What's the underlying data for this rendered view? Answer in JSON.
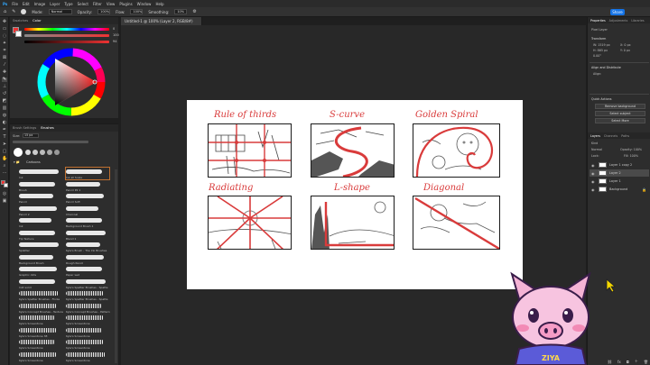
{
  "menu": [
    "Ps",
    "File",
    "Edit",
    "Image",
    "Layer",
    "Type",
    "Select",
    "Filter",
    "View",
    "Plugins",
    "Window",
    "Help"
  ],
  "options": {
    "mode_label": "Mode:",
    "mode_value": "Normal",
    "opacity_label": "Opacity:",
    "opacity_value": "100%",
    "flow_label": "Flow:",
    "flow_value": "100%",
    "smoothing_label": "Smoothing:",
    "smoothing_value": "10%",
    "share_label": "Share"
  },
  "color_panel": {
    "tabs": [
      "Swatches",
      "Color"
    ],
    "slider_values": [
      "0",
      "100",
      "94"
    ]
  },
  "brushes_panel": {
    "tabs": [
      "Brush Settings",
      "Brushes"
    ],
    "size_value": "15 px",
    "folder_name": "Cartoons",
    "brushes": [
      {
        "left": "Ink",
        "right": "Ink all Scale"
      },
      {
        "left": "Brush",
        "right": "Pencil P2 1"
      },
      {
        "left": "Pencil",
        "right": "Pencil Soft"
      },
      {
        "left": "Pencil 2",
        "right": "Charcoal"
      },
      {
        "left": "Ink",
        "right": "Background Brush 1"
      },
      {
        "left": "Tip Texture",
        "right": "Blend 1"
      },
      {
        "left": "Splatter",
        "right": "Kyle's Brush - The Ink Brushes"
      },
      {
        "left": "Background Brush",
        "right": "Rough Pencil"
      },
      {
        "left": "Graphic dots",
        "right": "Paper wet"
      },
      {
        "left": "Inkt solid",
        "right": "Kyle's Spatter Brushes - Spatte"
      },
      {
        "left": "Kyle's Spatter Brushes - Flicke",
        "right": "Kyle's Spatter Brushes - Spatte"
      },
      {
        "left": "Kyle's Concept Brushes - Texture",
        "right": "Kyle's Concept Brushes - Pattern"
      },
      {
        "left": "Kyle's Screentone",
        "right": "Kyle's Screentone"
      },
      {
        "left": "Kyle's Screentone 38",
        "right": "Kyle's Screentone"
      },
      {
        "left": "Kyle's Screentone",
        "right": "Kyle's Screentone"
      },
      {
        "left": "Kyle's Screentone",
        "right": "Kyle's Screentone"
      }
    ]
  },
  "document": {
    "tab_title": "Untitled-1 @ 100% (Layer 2, RGB/8#)",
    "zoom": "100%"
  },
  "artboard": {
    "labels": [
      "Rule of thirds",
      "S-curve",
      "Golden Spiral",
      "Radiating",
      "L-shape",
      "Diagonal"
    ],
    "accent_color": "#d93b3b"
  },
  "right_panel": {
    "top_tabs": [
      "Properties",
      "Adjustments",
      "Libraries"
    ],
    "pixel_layer": "Pixel Layer",
    "transform_label": "Transform",
    "transform_values": [
      "W: 1519 px",
      "H: 865 px",
      "X: 0 px",
      "Y: 0 px",
      "0.00°"
    ],
    "align_label": "Align and Distribute",
    "align_sub": "Align:",
    "quick_actions": "Quick Actions",
    "buttons": [
      "Remove background",
      "Select subject",
      "Select More"
    ],
    "layer_tabs": [
      "Layers",
      "Channels",
      "Paths"
    ],
    "kind_label": "Kind",
    "blend_mode": "Normal",
    "opacity": "Opacity: 100%",
    "lock_label": "Lock:",
    "fill": "Fill: 100%",
    "layers": [
      "Layer 1 copy 2",
      "Layer 2",
      "Layer 1",
      "Background"
    ]
  },
  "mascot": {
    "badge": "ZIYA"
  }
}
